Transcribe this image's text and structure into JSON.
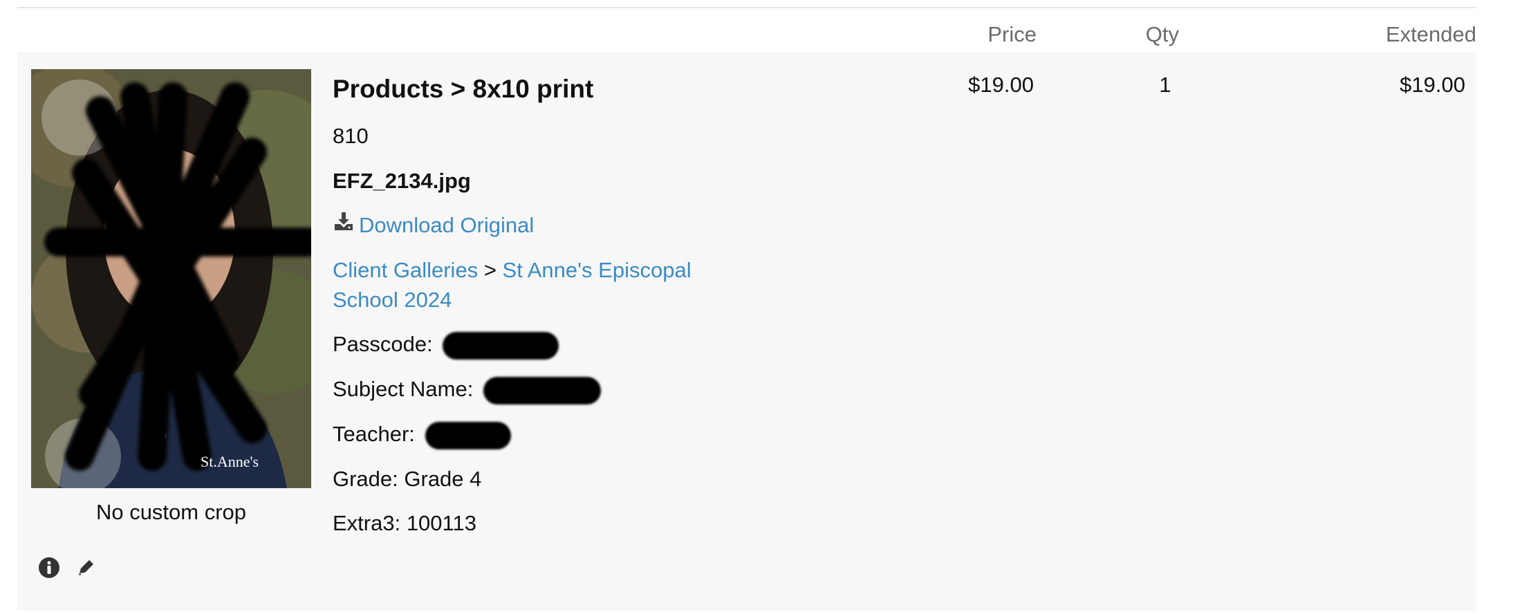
{
  "columns": {
    "price": "Price",
    "qty": "Qty",
    "extended": "Extended"
  },
  "item": {
    "product_title": "Products > 8x10 print",
    "product_code": "810",
    "filename": "EFZ_2134.jpg",
    "download_label": "Download Original",
    "breadcrumb": {
      "root": "Client Galleries",
      "separator": " > ",
      "gallery": "St Anne's Episcopal School 2024"
    },
    "fields": {
      "passcode_label": "Passcode:",
      "subject_name_label": "Subject Name:",
      "teacher_label": "Teacher:",
      "grade": "Grade: Grade 4",
      "extra3": "Extra3: 100113"
    },
    "crop_status": "No custom crop",
    "price": "$19.00",
    "qty": "1",
    "extended": "$19.00",
    "thumbnail_badge": "St.Anne's"
  },
  "colors": {
    "link": "#3a8bc4",
    "panel_bg": "#f7f7f7",
    "header_text": "#6b6b6b"
  },
  "icons": {
    "download": "download-icon",
    "info": "info-icon",
    "edit": "pencil-icon"
  }
}
